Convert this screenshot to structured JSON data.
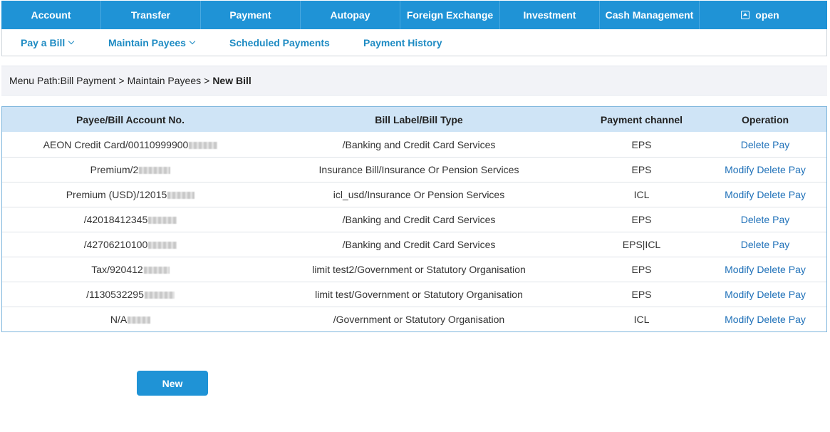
{
  "top_nav": [
    {
      "label": "Account"
    },
    {
      "label": "Transfer"
    },
    {
      "label": "Payment"
    },
    {
      "label": "Autopay"
    },
    {
      "label": "Foreign Exchange"
    },
    {
      "label": "Investment"
    },
    {
      "label": "Cash Management"
    },
    {
      "label": "open",
      "icon": "open-icon"
    }
  ],
  "sub_nav": [
    {
      "label": "Pay a Bill",
      "has_dropdown": true
    },
    {
      "label": "Maintain Payees",
      "has_dropdown": true
    },
    {
      "label": "Scheduled Payments",
      "has_dropdown": false
    },
    {
      "label": "Payment History",
      "has_dropdown": false
    }
  ],
  "breadcrumb": {
    "prefix": "Menu Path:",
    "path1": "Bill Payment",
    "separator": ">",
    "path2": "Maintain Payees",
    "current": "New Bill"
  },
  "table": {
    "headers": [
      "Payee/Bill Account No.",
      "Bill Label/Bill Type",
      "Payment channel",
      "Operation"
    ],
    "rows": [
      {
        "account": "AEON Credit Card/00110999900",
        "label": "/Banking and Credit Card Services",
        "channel": "EPS",
        "ops": [
          "Delete",
          "Pay"
        ]
      },
      {
        "account": "Premium/2",
        "label": "Insurance Bill/Insurance Or Pension Services",
        "channel": "EPS",
        "ops": [
          "Modify",
          "Delete",
          "Pay"
        ]
      },
      {
        "account": "Premium (USD)/12015",
        "label": "icl_usd/Insurance Or Pension Services",
        "channel": "ICL",
        "ops": [
          "Modify",
          "Delete",
          "Pay"
        ]
      },
      {
        "account": "/42018412345",
        "label": "/Banking and Credit Card Services",
        "channel": "EPS",
        "ops": [
          "Delete",
          "Pay"
        ]
      },
      {
        "account": "/42706210100",
        "label": "/Banking and Credit Card Services",
        "channel": "EPS|ICL",
        "ops": [
          "Delete",
          "Pay"
        ]
      },
      {
        "account": "Tax/920412",
        "label": "limit test2/Government or Statutory Organisation",
        "channel": "EPS",
        "ops": [
          "Modify",
          "Delete",
          "Pay"
        ]
      },
      {
        "account": "/1130532295",
        "label": "limit test/Government or Statutory Organisation",
        "channel": "EPS",
        "ops": [
          "Modify",
          "Delete",
          "Pay"
        ]
      },
      {
        "account": "N/A",
        "label": "/Government or Statutory Organisation",
        "channel": "ICL",
        "ops": [
          "Modify",
          "Delete",
          "Pay"
        ]
      }
    ]
  },
  "new_button": "New",
  "colors": {
    "nav_blue": "#1f93d6",
    "link_blue": "#1e70b8",
    "sub_nav_blue": "#1e8bc3",
    "header_bg": "#cfe4f6"
  }
}
